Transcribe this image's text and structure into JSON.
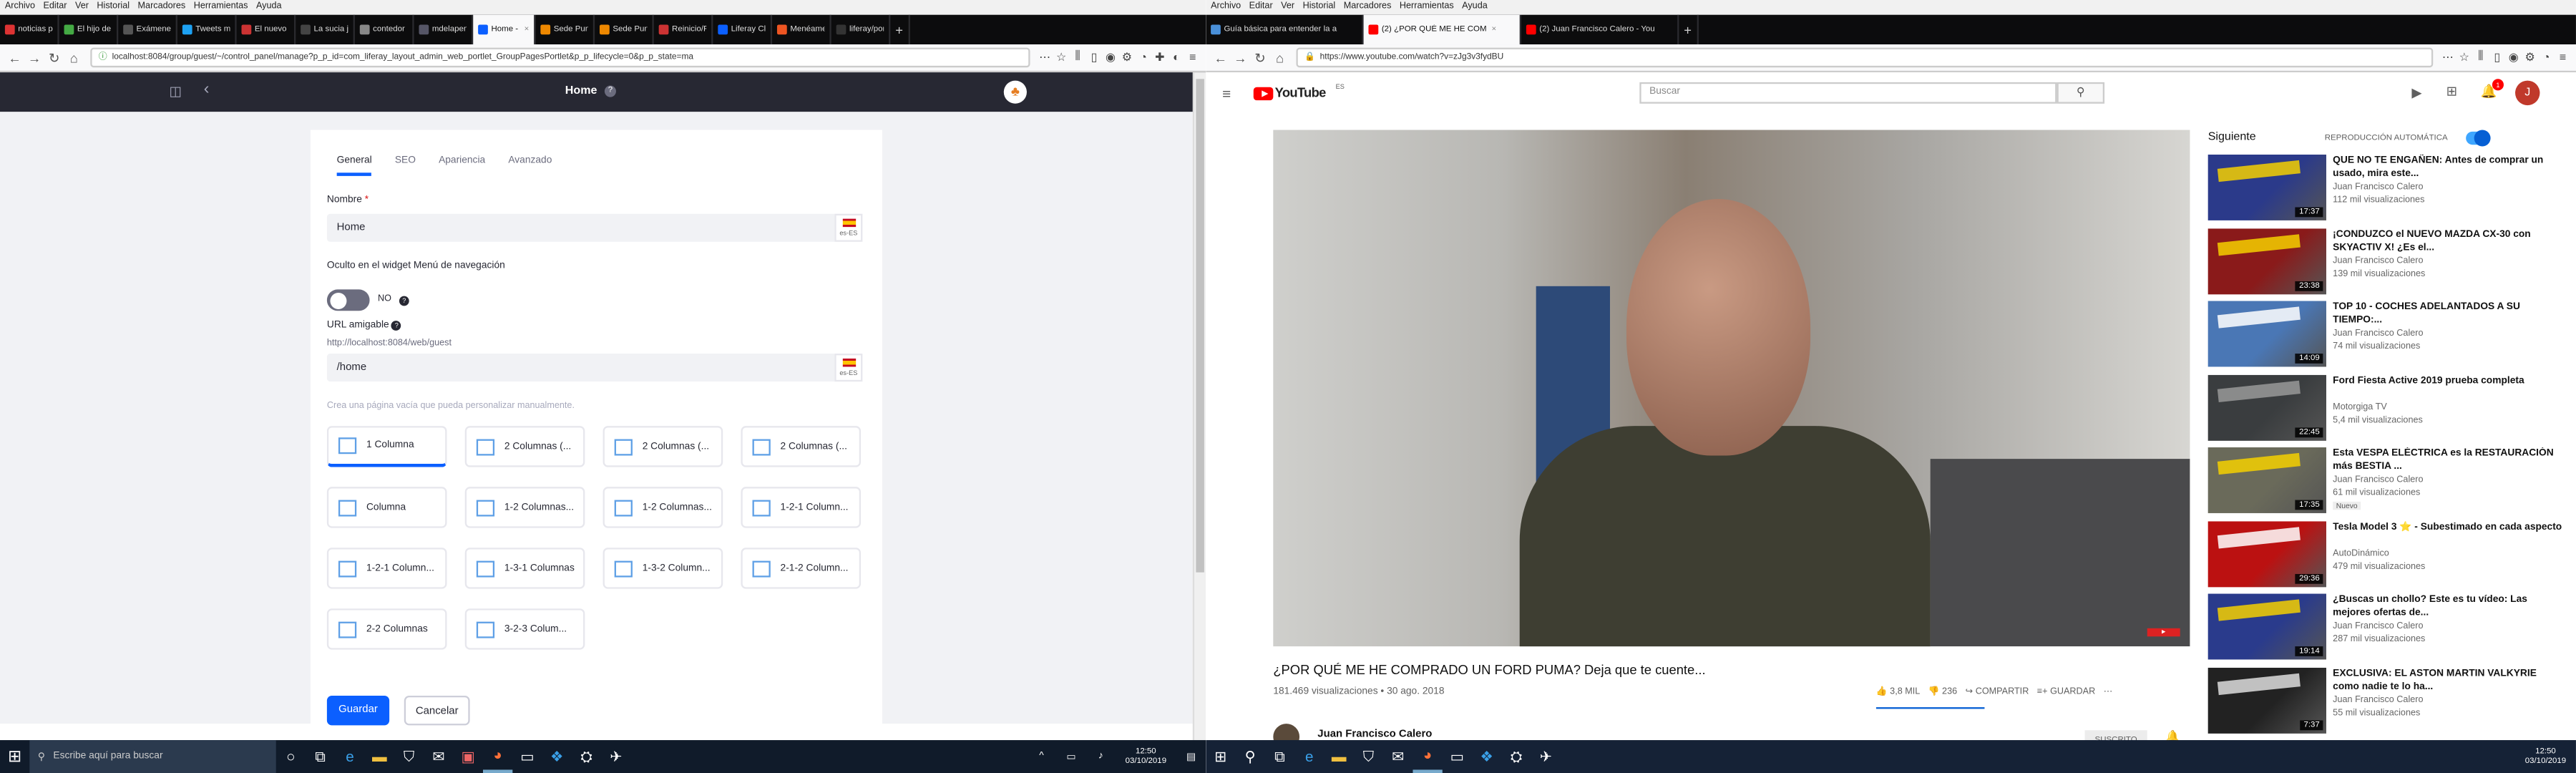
{
  "left": {
    "menu": [
      "Archivo",
      "Editar",
      "Ver",
      "Historial",
      "Marcadores",
      "Herramientas",
      "Ayuda"
    ],
    "tabs": [
      {
        "label": "noticias per",
        "color": "#d33"
      },
      {
        "label": "El hijo de",
        "color": "#4a4"
      },
      {
        "label": "Exámenes",
        "color": "#555"
      },
      {
        "label": "Tweets más",
        "color": "#1da1f2"
      },
      {
        "label": "El nuevo Ha",
        "color": "#c33"
      },
      {
        "label": "La sucia jug",
        "color": "#444"
      },
      {
        "label": "contedor de",
        "color": "#888"
      },
      {
        "label": "mdelapengu",
        "color": "#556"
      },
      {
        "label": "Home - L",
        "color": "#0b5fff",
        "active": true
      },
      {
        "label": "Sede Punto",
        "color": "#e80"
      },
      {
        "label": "Sede Punto",
        "color": "#e80"
      },
      {
        "label": "Reinicio/Re",
        "color": "#c33"
      },
      {
        "label": "Liferay Clou",
        "color": "#0b5fff"
      },
      {
        "label": "Menéame",
        "color": "#e52"
      },
      {
        "label": "liferay/port",
        "color": "#333"
      }
    ],
    "url": "localhost:8084/group/guest/~/control_panel/manage?p_p_id=com_liferay_layout_admin_web_portlet_GroupPagesPortlet&p_p_lifecycle=0&p_p_state=ma",
    "header_title": "Home",
    "form_tabs": [
      "General",
      "SEO",
      "Apariencia",
      "Avanzado"
    ],
    "name_label": "Nombre",
    "name_required": "*",
    "name_value": "Home",
    "locale": "es-ES",
    "hidden_label": "Oculto en el widget Menú de navegación",
    "toggle_state": "NO",
    "friendly_label": "URL amigable",
    "friendly_prefix": "http://localhost:8084/web/guest",
    "friendly_value": "/home",
    "hint": "Crea una página vacía que pueda personalizar manualmente.",
    "templates": [
      "1 Columna",
      "2 Columnas (...",
      "2 Columnas (...",
      "2 Columnas (...",
      "Columna",
      "1-2 Columnas...",
      "1-2 Columnas...",
      "1-2-1 Column...",
      "1-2-1 Column...",
      "1-3-1 Columnas",
      "1-3-2 Column...",
      "2-1-2 Column...",
      "2-2 Columnas",
      "3-2-3 Colum..."
    ],
    "save": "Guardar",
    "cancel": "Cancelar",
    "search_placeholder": "Escribe aquí para buscar",
    "clock_time": "12:50",
    "clock_date": "03/10/2019"
  },
  "right": {
    "menu": [
      "Archivo",
      "Editar",
      "Ver",
      "Historial",
      "Marcadores",
      "Herramientas",
      "Ayuda"
    ],
    "tabs": [
      {
        "label": "Guía básica para entender la a",
        "color": "#4a90d9"
      },
      {
        "label": "(2) ¿POR QUÉ ME HE COM",
        "color": "#f00",
        "active": true
      },
      {
        "label": "(2) Juan Francisco Calero - You",
        "color": "#f00"
      }
    ],
    "url": "https://www.youtube.com/watch?v=zJg3v3fydBU",
    "logo": "YouTube",
    "logo_region": "ES",
    "search_placeholder": "Buscar",
    "notif_count": "1",
    "avatar_letter": "J",
    "video_title": "¿POR QUÉ ME HE COMPRADO UN FORD PUMA? Deja que te cuente...",
    "video_meta": "181.469 visualizaciones • 30 ago. 2018",
    "likes": "3,8 MIL",
    "dislikes": "236",
    "share": "COMPARTIR",
    "save": "GUARDAR",
    "channel": "Juan Francisco Calero",
    "subscribed": "SUSCRITO",
    "next_label": "Siguiente",
    "autoplay_label": "REPRODUCCIÓN AUTOMÁTICA",
    "sidebar": [
      {
        "title": "QUE NO TE ENGAÑEN: Antes de comprar un usado, mira este...",
        "channel": "Juan Francisco Calero",
        "views": "112 mil visualizaciones",
        "duration": "17:37",
        "bg": "#2b3a8a",
        "accent": "#f5d000",
        "badge": ""
      },
      {
        "title": "¡CONDUZCO el NUEVO MAZDA CX-30 con SKYACTIV X! ¿Es el...",
        "channel": "Juan Francisco Calero",
        "views": "139 mil visualizaciones",
        "duration": "23:38",
        "bg": "#8a1a1a",
        "accent": "#f5d000",
        "badge": ""
      },
      {
        "title": "TOP 10 - COCHES ADELANTADOS A SU TIEMPO:...",
        "channel": "Juan Francisco Calero",
        "views": "74 mil visualizaciones",
        "duration": "14:09",
        "bg": "#4a77b5",
        "accent": "#ffffff",
        "badge": ""
      },
      {
        "title": "Ford Fiesta Active 2019 prueba completa",
        "channel": "Motorgiga TV",
        "views": "5,4 mil visualizaciones",
        "duration": "22:45",
        "bg": "#3a3d3f",
        "accent": "#999999",
        "badge": ""
      },
      {
        "title": "Esta VESPA ELÉCTRICA es la RESTAURACIÓN más BESTIA ...",
        "channel": "Juan Francisco Calero",
        "views": "61 mil visualizaciones",
        "duration": "17:35",
        "bg": "#6a6a5a",
        "accent": "#f5d000",
        "badge": "Nuevo"
      },
      {
        "title": "Tesla Model 3 ⭐ - Subestimado en cada aspecto",
        "channel": "AutoDinámico",
        "views": "479 mil visualizaciones",
        "duration": "29:36",
        "bg": "#b11",
        "accent": "#ffffff",
        "badge": ""
      },
      {
        "title": "¿Buscas un chollo? Este es tu vídeo: Las mejores ofertas de...",
        "channel": "Juan Francisco Calero",
        "views": "287 mil visualizaciones",
        "duration": "19:14",
        "bg": "#2a3b8c",
        "accent": "#f5d000",
        "badge": ""
      },
      {
        "title": "EXCLUSIVA: EL ASTON MARTIN VALKYRIE como nadie te lo ha...",
        "channel": "Juan Francisco Calero",
        "views": "55 mil visualizaciones",
        "duration": "7:37",
        "bg": "#222",
        "accent": "#dddddd",
        "badge": ""
      }
    ],
    "clock_time": "12:50",
    "clock_date": "03/10/2019"
  }
}
